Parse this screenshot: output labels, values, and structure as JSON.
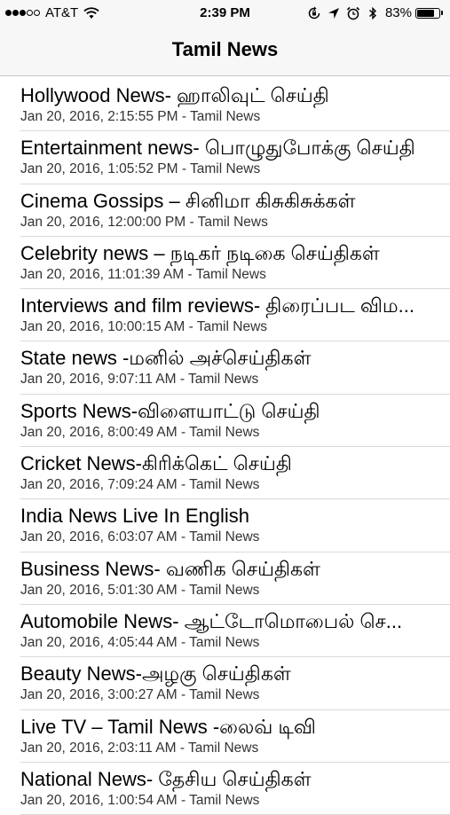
{
  "status_bar": {
    "carrier": "AT&T",
    "signal_filled": 3,
    "signal_total": 5,
    "time": "2:39 PM",
    "battery_text": "83%",
    "battery_level": 0.83,
    "icons": [
      "wifi-icon",
      "screen-rotation-lock-icon",
      "location-icon",
      "alarm-icon",
      "bluetooth-icon",
      "battery-icon"
    ]
  },
  "nav": {
    "title": "Tamil News"
  },
  "articles": [
    {
      "title": "Hollywood News- ஹாலிவுட் செய்தி",
      "meta": "Jan 20, 2016, 2:15:55 PM - Tamil News"
    },
    {
      "title": "Entertainment news- பொழுதுபோக்கு செய்தி",
      "meta": "Jan 20, 2016, 1:05:52 PM - Tamil News"
    },
    {
      "title": "Cinema Gossips – சினிமா கிசுகிசுக்கள்",
      "meta": "Jan 20, 2016, 12:00:00 PM - Tamil News"
    },
    {
      "title": "Celebrity  news – நடிகர் நடிகை செய்திகள்",
      "meta": "Jan 20, 2016, 11:01:39 AM - Tamil News"
    },
    {
      "title": "Interviews and film reviews- திரைப்பட விம...",
      "meta": "Jan 20, 2016, 10:00:15 AM - Tamil News"
    },
    {
      "title": "State news  -மனில்  அச்செய்திகள்",
      "meta": "Jan 20, 2016, 9:07:11 AM - Tamil News"
    },
    {
      "title": "Sports News-விளையாட்டு செய்தி",
      "meta": "Jan 20, 2016, 8:00:49 AM - Tamil News"
    },
    {
      "title": "Cricket News-கிரிக்கெட் செய்தி",
      "meta": "Jan 20, 2016, 7:09:24 AM - Tamil News"
    },
    {
      "title": "India News Live In English",
      "meta": "Jan 20, 2016, 6:03:07 AM - Tamil News"
    },
    {
      "title": "Business News- வணிக செய்திகள்",
      "meta": "Jan 20, 2016, 5:01:30 AM - Tamil News"
    },
    {
      "title": "Automobile News- ஆட்டோமொபைல் செ...",
      "meta": "Jan 20, 2016, 4:05:44 AM - Tamil News"
    },
    {
      "title": "Beauty News-அழகு செய்திகள்",
      "meta": "Jan 20, 2016, 3:00:27 AM - Tamil News"
    },
    {
      "title": "Live TV – Tamil News -லைவ் டிவி",
      "meta": "Jan 20, 2016, 2:03:11 AM - Tamil News"
    },
    {
      "title": "National  News- தேசிய செய்திகள்",
      "meta": "Jan 20, 2016, 1:00:54 AM - Tamil News"
    }
  ]
}
